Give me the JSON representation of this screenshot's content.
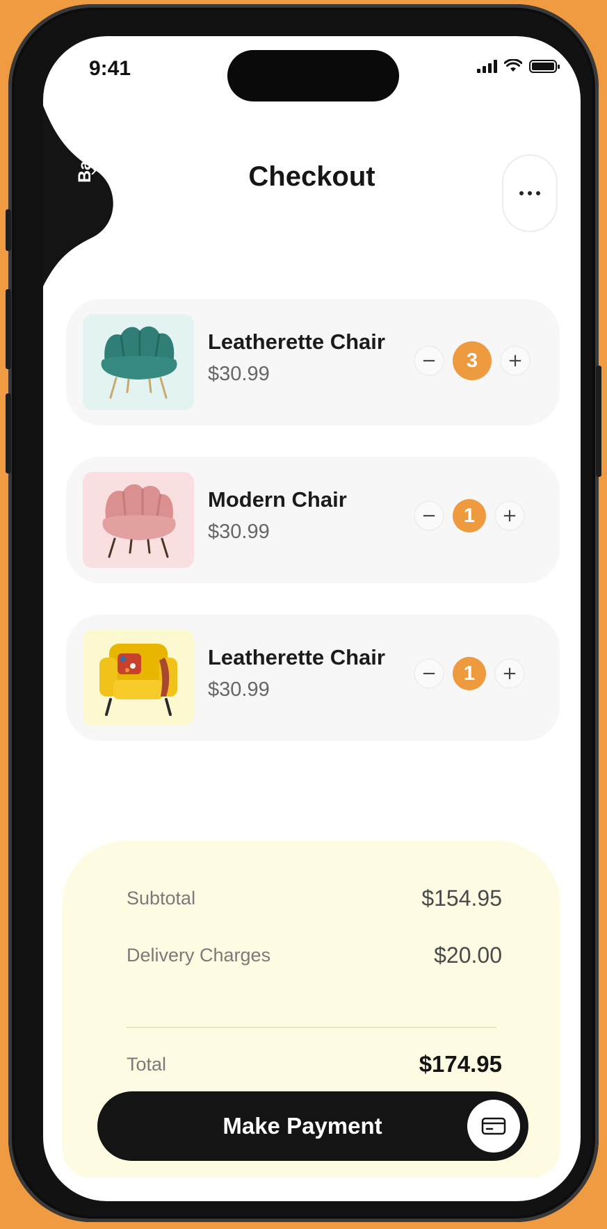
{
  "status_bar": {
    "time": "9:41",
    "icons": [
      "signal-icon",
      "wifi-icon",
      "battery-icon"
    ]
  },
  "header": {
    "back_label": "Back",
    "title": "Checkout",
    "menu_icon": "more-horizontal-icon"
  },
  "cart": {
    "items": [
      {
        "name": "Leatherette Chair",
        "price": "$30.99",
        "quantity": "3",
        "image": "teal-scallop-chair",
        "bg_color": "#e3f3f1"
      },
      {
        "name": "Modern Chair",
        "price": "$30.99",
        "quantity": "1",
        "image": "pink-scallop-chair",
        "bg_color": "#f9dfe0"
      },
      {
        "name": "Leatherette Chair",
        "price": "$30.99",
        "quantity": "1",
        "image": "yellow-wingback-chair",
        "bg_color": "#fcf8cf"
      }
    ],
    "decrement_icon": "minus-icon",
    "increment_icon": "plus-icon"
  },
  "summary": {
    "subtotal_label": "Subtotal",
    "subtotal_value": "$154.95",
    "delivery_label": "Delivery Charges",
    "delivery_value": "$20.00",
    "total_label": "Total",
    "total_value": "$174.95"
  },
  "payment": {
    "button_label": "Make Payment",
    "icon": "credit-card-icon"
  },
  "colors": {
    "accent": "#ee9a3f",
    "background": "#ef9b42",
    "dark": "#141414",
    "summary_bg": "#fdfbe2"
  }
}
